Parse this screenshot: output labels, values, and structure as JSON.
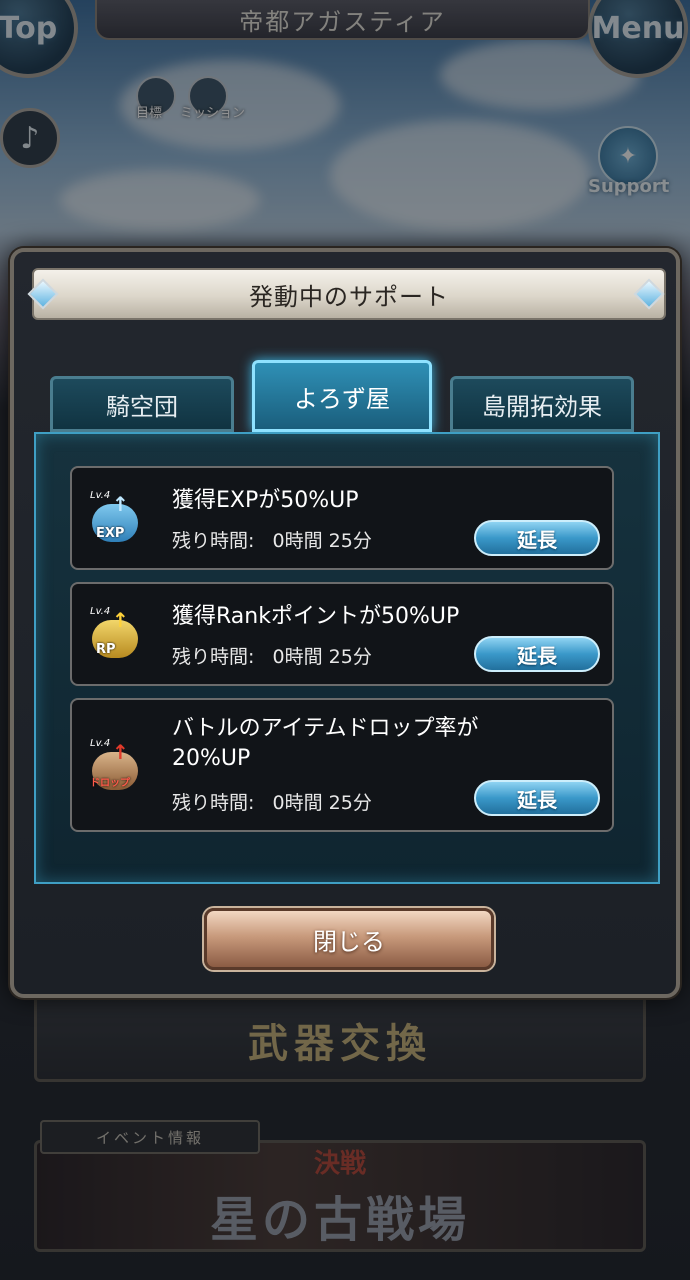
{
  "header": {
    "location": "帝都アガスティア",
    "top_label": "Top",
    "menu_label": "Menu"
  },
  "quick_icons": [
    {
      "label": "目標"
    },
    {
      "label": "ミッション"
    }
  ],
  "support_label": "Support",
  "background_banners": {
    "weapon_exchange": "武器交換",
    "event_tag": "イベント情報",
    "event_sub": "決戦",
    "event_title": "星の古戦場"
  },
  "modal": {
    "title": "発動中のサポート",
    "tabs": [
      {
        "label": "騎空団",
        "active": false
      },
      {
        "label": "よろず屋",
        "active": true
      },
      {
        "label": "島開拓効果",
        "active": false
      }
    ],
    "effects": [
      {
        "icon": "exp-up-icon",
        "level": "Lv.4",
        "icon_tag": "EXP",
        "title": "獲得EXPが50%UP",
        "time_label": "残り時間:",
        "time_value": "0時間 25分",
        "button": "延長"
      },
      {
        "icon": "rank-point-up-icon",
        "level": "Lv.4",
        "icon_tag": "RP",
        "title": "獲得Rankポイントが50%UP",
        "time_label": "残り時間:",
        "time_value": "0時間 25分",
        "button": "延長"
      },
      {
        "icon": "item-drop-up-icon",
        "level": "Lv.4",
        "icon_tag": "ドロップ",
        "title_line1": "バトルのアイテムドロップ率が",
        "title_line2": "20%UP",
        "time_label": "残り時間:",
        "time_value": "0時間 25分",
        "button": "延長"
      }
    ],
    "close_label": "閉じる"
  },
  "colors": {
    "tab_active": "#2f90b6",
    "panel_border": "#3f9fc4",
    "extend_button": "#3a98c9",
    "close_button": "#c89a7c"
  }
}
